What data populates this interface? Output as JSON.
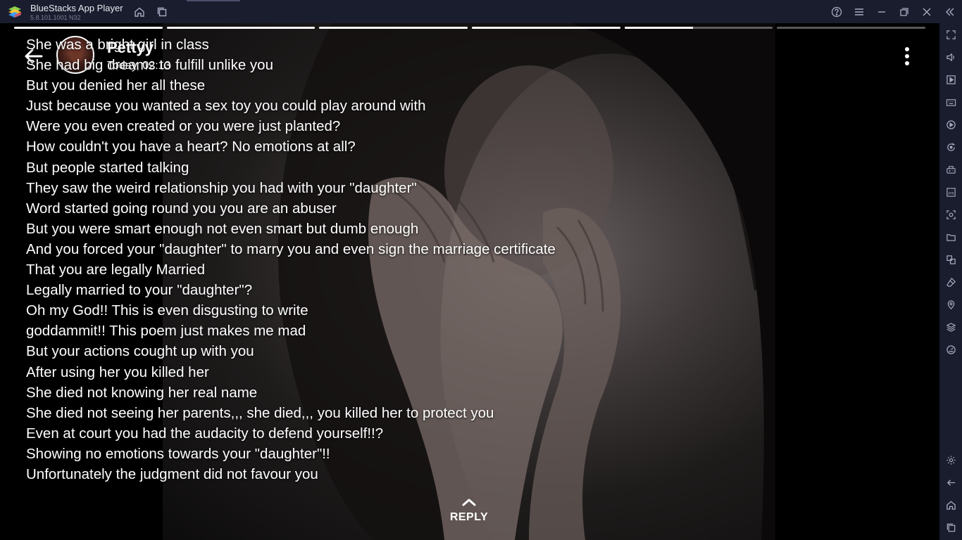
{
  "window": {
    "app_title": "BlueStacks App Player",
    "app_version": "5.8.101.1001 N32"
  },
  "story": {
    "contact_name": "Pettyy",
    "time": "Today, 02:13",
    "segments": [
      1,
      1,
      1,
      1,
      0.46,
      0
    ],
    "reply_label": "REPLY",
    "poem_lines": [
      "She was a bright girl in class",
      "She had big dreams to fulfill unlike you",
      "But you denied her all these",
      "Just because you wanted a sex toy you could play around with",
      "Were you even created or you were just planted?",
      "How couldn't you have a heart? No emotions at all?",
      "But people started talking",
      "They saw the weird relationship you had with your \"daughter\"",
      "Word started going round you you are an abuser",
      "But you were smart enough not even smart but dumb enough",
      "And you forced your \"daughter\" to marry you and even sign the marriage certificate",
      "That you are legally Married",
      "Legally married to your \"daughter\"?",
      "Oh my God!! This is even disgusting to write",
      "goddammit!! This poem just makes me mad",
      "But your actions cought up with you",
      "After using her you killed her",
      "She died not knowing her real name",
      "She died not seeing her parents,,, she died,,, you killed her to protect you",
      "Even at court you had the audacity to defend yourself!!?",
      "Showing no emotions towards your \"daughter\"!!",
      "Unfortunately the judgment did not favour you"
    ]
  },
  "titlebar_icons": [
    "home-icon",
    "multi-instance-icon",
    "help-icon",
    "menu-icon",
    "minimize-icon",
    "restore-icon",
    "close-icon",
    "collapse-sidebar-icon"
  ],
  "sidebar_icons": [
    "fullscreen-icon",
    "volume-icon",
    "play-icon",
    "keyboard-icon",
    "macro-icon",
    "rotate-icon",
    "gamepad-icon",
    "apk-icon",
    "screenshot-icon",
    "folder-icon",
    "multi-window-icon",
    "eraser-icon",
    "location-icon",
    "layers-icon",
    "eco-mode-icon",
    "settings-icon",
    "back-icon",
    "home-icon",
    "recents-icon"
  ],
  "colors": {
    "chrome": "#1a1d2e",
    "chrome_icon": "#a7abc0",
    "text": "#ffffff"
  }
}
